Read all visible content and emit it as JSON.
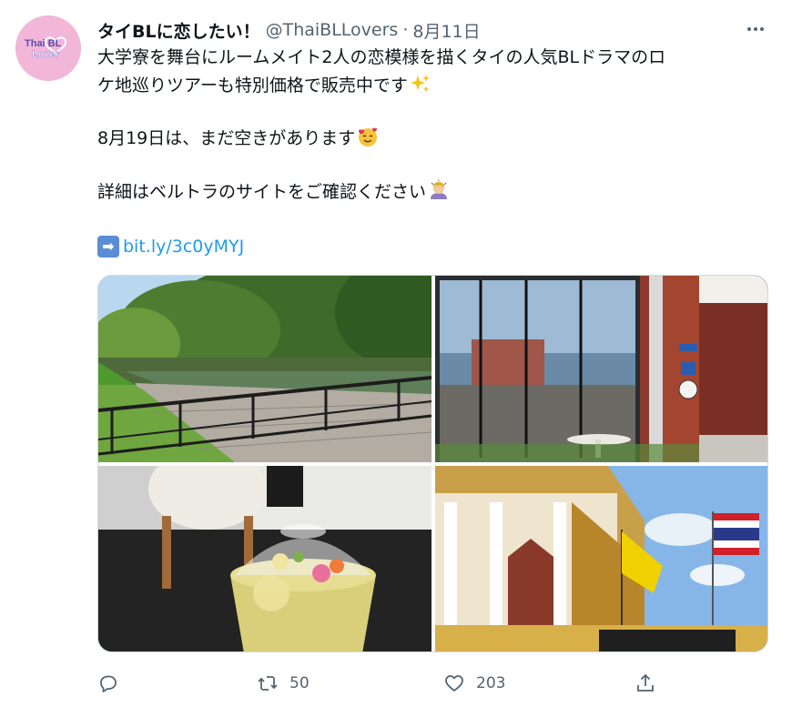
{
  "tweet": {
    "avatar_text": "Thai BL Lover",
    "display_name": "タイBLに恋したい！",
    "handle": "@ThaiBLLovers",
    "separator": "·",
    "date": "8月11日",
    "lines": [
      "大学寮を舞台にルームメイト2人の恋模様を描くタイの人気BLドラマのロ",
      "ケ地巡りツアーも特別価格で販売中です",
      "8月19日は、まだ空きがあります",
      "詳細はベルトラのサイトをご確認ください"
    ],
    "link_arrow": "➡",
    "link": "bit.ly/3c0yMYJ",
    "retweet_count": "50",
    "like_count": "203"
  },
  "icons": {
    "more": "more-options-icon",
    "sparkles": "sparkles-emoji",
    "smiling_hearts": "smiling-face-with-hearts-emoji",
    "bowing": "person-bowing-emoji",
    "arrow": "right-arrow-emoji",
    "reply": "reply-icon",
    "retweet": "retweet-icon",
    "like": "heart-icon",
    "share": "share-icon"
  },
  "colors": {
    "link": "#1d9bf0",
    "secondary_text": "#536471",
    "avatar_bg": "#f2b6d9"
  }
}
